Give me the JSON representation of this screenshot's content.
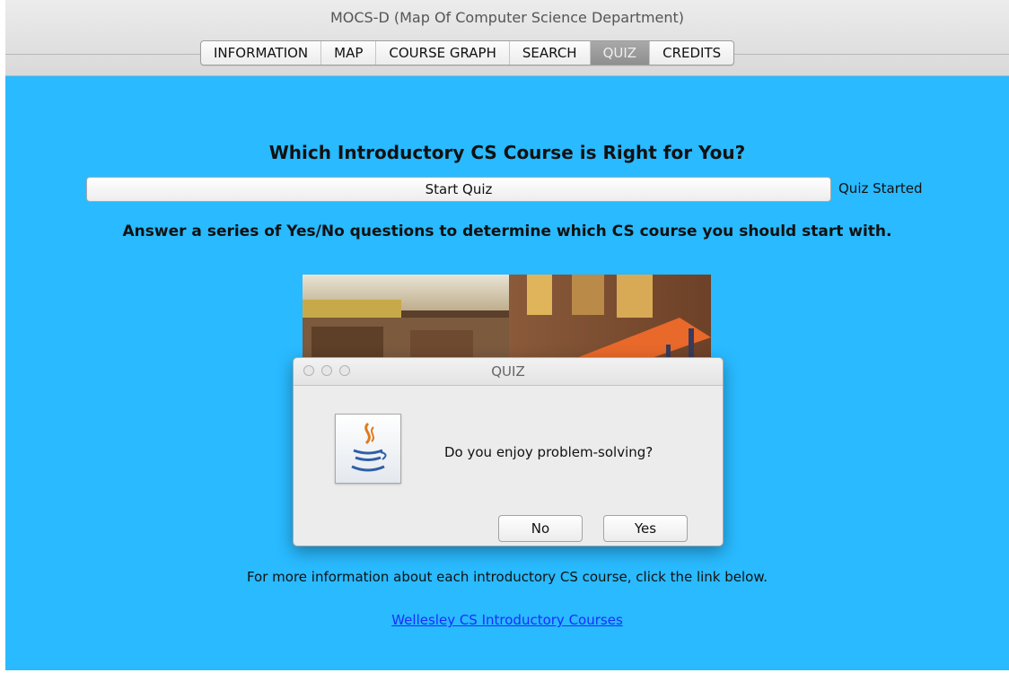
{
  "window": {
    "title": "MOCS-D (Map Of Computer Science Department)"
  },
  "tabs": [
    {
      "label": "INFORMATION",
      "active": false
    },
    {
      "label": "MAP",
      "active": false
    },
    {
      "label": "COURSE GRAPH",
      "active": false
    },
    {
      "label": "SEARCH",
      "active": false
    },
    {
      "label": "QUIZ",
      "active": true
    },
    {
      "label": "CREDITS",
      "active": false
    }
  ],
  "quiz": {
    "heading": "Which Introductory CS Course is Right for You?",
    "start_button": "Start Quiz",
    "status": "Quiz Started",
    "instructions": "Answer a series of Yes/No questions to determine which CS course you should start with.",
    "more_info": "For more information about each introductory CS course, click the link below.",
    "link_text": "Wellesley CS Introductory Courses"
  },
  "dialog": {
    "title": "QUIZ",
    "question": "Do you enjoy problem-solving?",
    "no_label": "No",
    "yes_label": "Yes",
    "icon": "java-coffee-icon"
  },
  "colors": {
    "panel_bg": "#29baff",
    "link": "#1a2dff",
    "active_tab": "#9a9a9a"
  }
}
